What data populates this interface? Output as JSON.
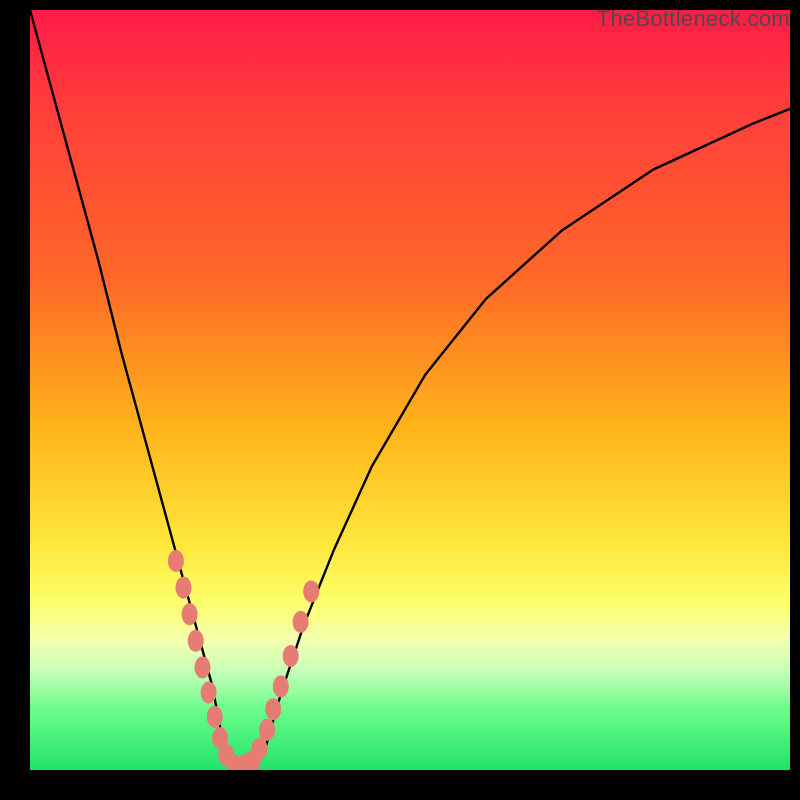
{
  "watermark": "TheBottleneck.com",
  "chart_data": {
    "type": "line",
    "title": "",
    "xlabel": "",
    "ylabel": "",
    "xlim": [
      0,
      100
    ],
    "ylim": [
      0,
      100
    ],
    "annotations": [],
    "series": [
      {
        "name": "bottleneck-curve",
        "color": "#000000",
        "x": [
          0,
          3,
          6,
          9,
          12,
          15,
          18,
          21,
          24,
          25.5,
          27,
          29,
          31,
          33,
          36,
          40,
          45,
          52,
          60,
          70,
          82,
          95,
          100
        ],
        "y": [
          100,
          89,
          78,
          67,
          55,
          44,
          33,
          22,
          11,
          3,
          0.5,
          0.5,
          3,
          10,
          19,
          29,
          40,
          52,
          62,
          71,
          79,
          85,
          87
        ]
      }
    ],
    "markers": {
      "name": "highlight-dots",
      "color": "#e77c74",
      "points": [
        {
          "x": 19.2,
          "y": 27.5
        },
        {
          "x": 20.2,
          "y": 24.0
        },
        {
          "x": 21.0,
          "y": 20.5
        },
        {
          "x": 21.8,
          "y": 17.0
        },
        {
          "x": 22.7,
          "y": 13.5
        },
        {
          "x": 23.5,
          "y": 10.2
        },
        {
          "x": 24.3,
          "y": 7.0
        },
        {
          "x": 25.0,
          "y": 4.2
        },
        {
          "x": 25.8,
          "y": 2.0
        },
        {
          "x": 26.9,
          "y": 0.6
        },
        {
          "x": 28.2,
          "y": 0.6
        },
        {
          "x": 29.3,
          "y": 1.2
        },
        {
          "x": 30.2,
          "y": 2.8
        },
        {
          "x": 31.2,
          "y": 5.3
        },
        {
          "x": 32.0,
          "y": 8.0
        },
        {
          "x": 33.0,
          "y": 11.0
        },
        {
          "x": 34.3,
          "y": 15.0
        },
        {
          "x": 35.6,
          "y": 19.5
        },
        {
          "x": 37.0,
          "y": 23.5
        }
      ]
    }
  }
}
